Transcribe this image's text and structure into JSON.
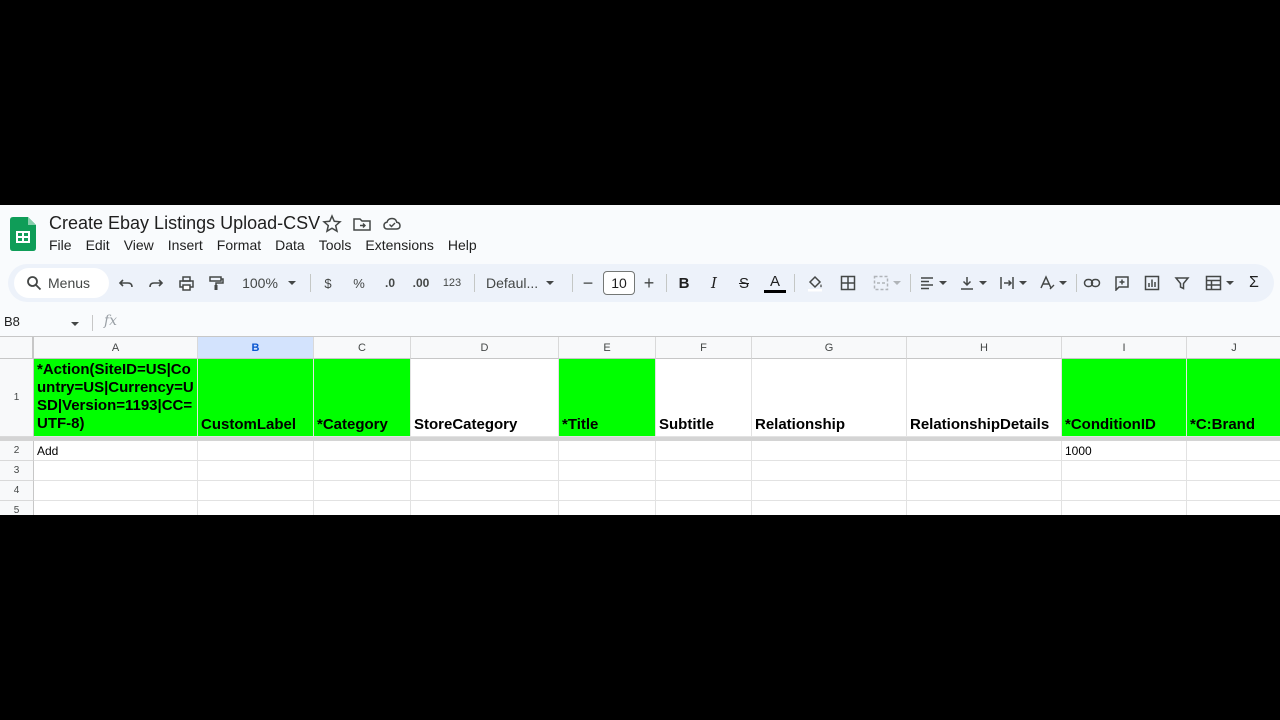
{
  "doc": {
    "title": "Create Ebay Listings Upload-CSV"
  },
  "menu": [
    "File",
    "Edit",
    "View",
    "Insert",
    "Format",
    "Data",
    "Tools",
    "Extensions",
    "Help"
  ],
  "toolbar": {
    "search_label": "Menus",
    "zoom": "100%",
    "currency": "$",
    "percent": "%",
    "dec_decrease": ".0",
    "dec_increase": ".00",
    "number_format": "123",
    "font": "Defaul...",
    "font_size": "10",
    "bold": "B",
    "italic": "I",
    "strike": "S",
    "text_color": "A",
    "sum": "Σ",
    "minus": "−",
    "plus": "+"
  },
  "formula_bar": {
    "cell_ref": "B8",
    "fx": "fx"
  },
  "columns": [
    "A",
    "B",
    "C",
    "D",
    "E",
    "F",
    "G",
    "H",
    "I",
    "J"
  ],
  "selected_column": "B",
  "rows": [
    "1",
    "2",
    "3",
    "4",
    "5"
  ],
  "row1": [
    "*Action(SiteID=US|Country=US|Currency=USD|Version=1193|CC=UTF-8)",
    "CustomLabel",
    "*Category",
    "StoreCategory",
    "*Title",
    "Subtitle",
    "Relationship",
    "RelationshipDetails",
    "*ConditionID",
    "*C:Brand"
  ],
  "row1_green": [
    true,
    true,
    true,
    false,
    true,
    false,
    false,
    false,
    true,
    true
  ],
  "row2": [
    "Add",
    "",
    "",
    "",
    "",
    "",
    "",
    "",
    "1000",
    ""
  ],
  "colors": {
    "header_green": "#00ff00",
    "selected_col": "#d3e3fd",
    "sheets_green": "#0f9d58"
  }
}
